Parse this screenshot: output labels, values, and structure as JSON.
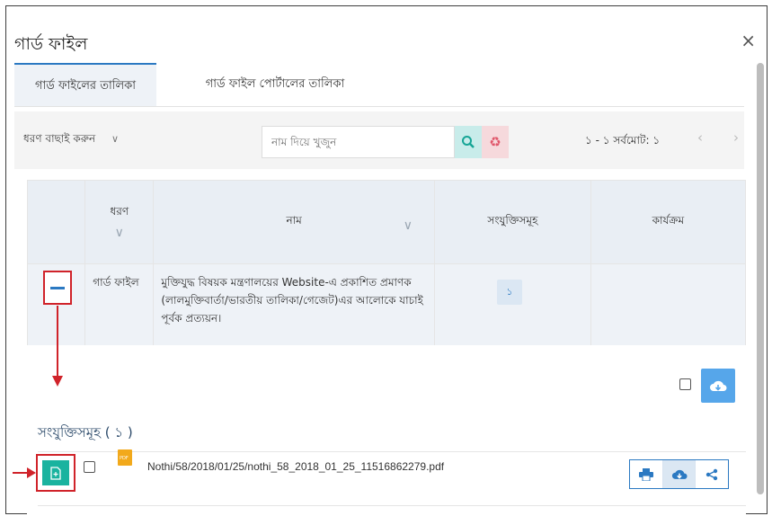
{
  "dialog": {
    "title": "গার্ড ফাইল",
    "close_icon": "×"
  },
  "tabs": [
    {
      "label": "গার্ড ফাইলের তালিকা",
      "active": true
    },
    {
      "label": "গার্ড ফাইল পোর্টালের তালিকা",
      "active": false
    }
  ],
  "toolbar": {
    "filter_label": "ধরণ বাছাই করুন",
    "filter_chevron": "∨",
    "search_placeholder": "নাম দিয়ে খুজুন",
    "pager_text": "১ - ১  সর্বমোট: ১",
    "prev": "‹",
    "next": "›"
  },
  "table": {
    "headers": {
      "type": "ধরণ",
      "name": "নাম",
      "attachments": "সংযুক্তিসমূহ",
      "actions": "কার্যক্রম"
    },
    "sort_chevron": "∨",
    "row": {
      "type": "গার্ড ফাইল",
      "name": "মুক্তিযুদ্ধ বিষয়ক মন্ত্রণালয়ের Website-এ প্রকাশিত প্রমাণক (লালমুক্তিবার্তা/ভারতীয় তালিকা/গেজেট)এর আলোকে যাচাই পূর্বক প্রত্যয়ন।",
      "attachment_count": "১"
    }
  },
  "attachments": {
    "title": "সংযুক্তিসমূহ ( ১ )",
    "files": [
      {
        "name": "Nothi/58/2018/01/25/nothi_58_2018_01_25_11516862279.pdf",
        "pdf_label": "PDF"
      }
    ]
  },
  "colors": {
    "accent": "#2b79c2",
    "annotation": "#d0232a",
    "teal": "#1ab39f"
  }
}
